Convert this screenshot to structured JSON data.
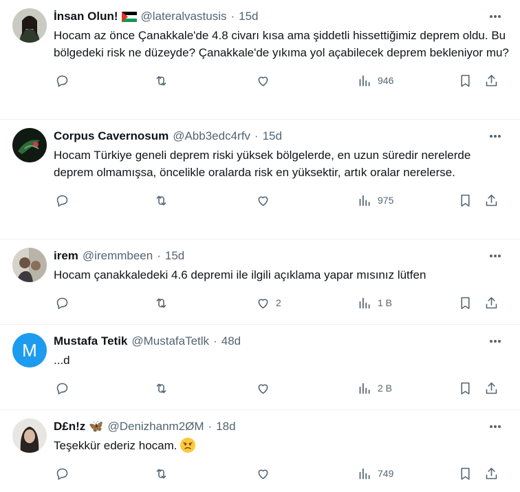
{
  "tweets": [
    {
      "name": "İnsan Olun!",
      "handle": "@lateralvastusis",
      "time": "15d",
      "text": "Hocam az önce Çanakkale'de 4.8 civarı kısa ama şiddetli hissettiğimiz deprem oldu. Bu bölgedeki risk ne düzeyde? Çanakkale'de yıkıma yol açabilecek deprem bekleniyor mu?",
      "likes": "",
      "views": "946"
    },
    {
      "name": "Corpus Cavernosum",
      "handle": "@Abb3edc4rfv",
      "time": "15d",
      "text": "Hocam Türkiye geneli deprem riski yüksek bölgelerde, en uzun süredir nerelerde deprem olmamışsa, öncelikle oralarda risk en yüksektir, artık oralar nerelerse.",
      "likes": "",
      "views": "975"
    },
    {
      "name": "irem",
      "handle": "@iremmbeen",
      "time": "15d",
      "text": "Hocam çanakkaledeki 4.6 depremi ile ilgili açıklama yapar mısınız lütfen",
      "likes": "2",
      "views": "1 B"
    },
    {
      "name": "Mustafa Tetik",
      "handle": "@MustafaTetlk",
      "time": "48d",
      "avatar_letter": "M",
      "text": "...d",
      "likes": "",
      "views": "2 B"
    },
    {
      "name": "D£n!z",
      "handle": "@Denizhanm2ØM",
      "time": "18d",
      "text": "Teşekkür ederiz hocam.",
      "likes": "",
      "views": "749"
    }
  ],
  "colors": {
    "accent": "#1d9bf0",
    "muted": "#536471",
    "text": "#0f1419",
    "border": "#eff3f4"
  }
}
